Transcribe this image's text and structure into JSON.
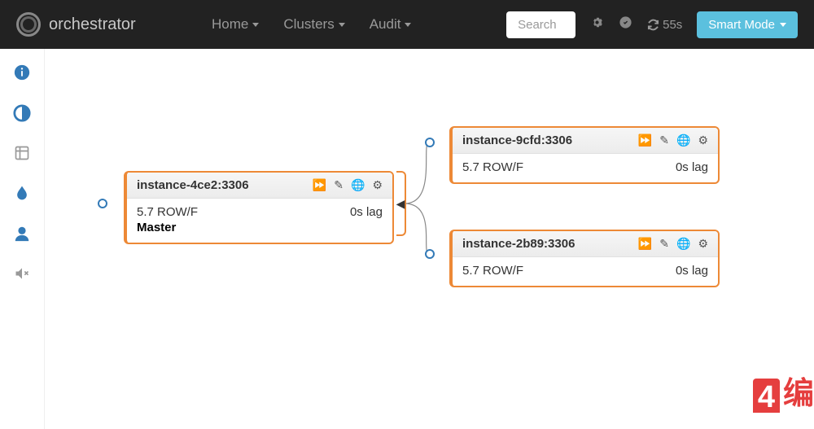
{
  "navbar": {
    "brand": "orchestrator",
    "links": {
      "home": "Home",
      "clusters": "Clusters",
      "audit": "Audit"
    },
    "search_placeholder": "Search",
    "refresh_label": "55s",
    "smart_mode": "Smart Mode"
  },
  "nodes": {
    "master": {
      "title": "instance-4ce2:3306",
      "version": "5.7 ROW/F",
      "lag": "0s lag",
      "role": "Master"
    },
    "replica1": {
      "title": "instance-9cfd:3306",
      "version": "5.7 ROW/F",
      "lag": "0s lag"
    },
    "replica2": {
      "title": "instance-2b89:3306",
      "version": "5.7 ROW/F",
      "lag": "0s lag"
    }
  },
  "watermark": {
    "badge": "4",
    "text": "编"
  }
}
